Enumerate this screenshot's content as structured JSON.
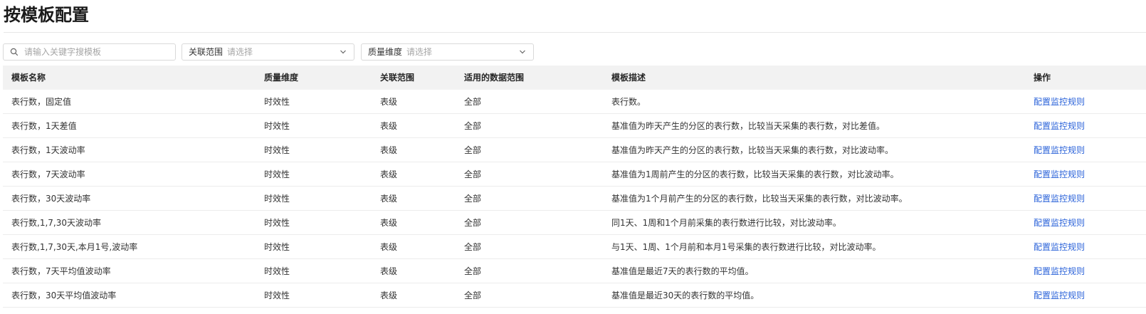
{
  "page": {
    "title": "按模板配置"
  },
  "filters": {
    "search_placeholder": "请输入关键字搜模板",
    "scope": {
      "label": "关联范围",
      "placeholder": "请选择"
    },
    "dimension": {
      "label": "质量维度",
      "placeholder": "请选择"
    }
  },
  "table": {
    "headers": [
      "模板名称",
      "质量维度",
      "关联范围",
      "适用的数据范围",
      "模板描述",
      "操作"
    ],
    "rows": [
      {
        "name": "表行数，固定值",
        "dimension": "时效性",
        "scope": "表级",
        "data_range": "全部",
        "desc": "表行数。",
        "action": "配置监控规则"
      },
      {
        "name": "表行数，1天差值",
        "dimension": "时效性",
        "scope": "表级",
        "data_range": "全部",
        "desc": "基准值为昨天产生的分区的表行数，比较当天采集的表行数，对比差值。",
        "action": "配置监控规则"
      },
      {
        "name": "表行数，1天波动率",
        "dimension": "时效性",
        "scope": "表级",
        "data_range": "全部",
        "desc": "基准值为昨天产生的分区的表行数，比较当天采集的表行数，对比波动率。",
        "action": "配置监控规则"
      },
      {
        "name": "表行数，7天波动率",
        "dimension": "时效性",
        "scope": "表级",
        "data_range": "全部",
        "desc": "基准值为1周前产生的分区的表行数，比较当天采集的表行数，对比波动率。",
        "action": "配置监控规则"
      },
      {
        "name": "表行数，30天波动率",
        "dimension": "时效性",
        "scope": "表级",
        "data_range": "全部",
        "desc": "基准值为1个月前产生的分区的表行数，比较当天采集的表行数，对比波动率。",
        "action": "配置监控规则"
      },
      {
        "name": "表行数,1,7,30天波动率",
        "dimension": "时效性",
        "scope": "表级",
        "data_range": "全部",
        "desc": "同1天、1周和1个月前采集的表行数进行比较，对比波动率。",
        "action": "配置监控规则"
      },
      {
        "name": "表行数,1,7,30天,本月1号,波动率",
        "dimension": "时效性",
        "scope": "表级",
        "data_range": "全部",
        "desc": "与1天、1周、1个月前和本月1号采集的表行数进行比较，对比波动率。",
        "action": "配置监控规则"
      },
      {
        "name": "表行数，7天平均值波动率",
        "dimension": "时效性",
        "scope": "表级",
        "data_range": "全部",
        "desc": "基准值是最近7天的表行数的平均值。",
        "action": "配置监控规则"
      },
      {
        "name": "表行数，30天平均值波动率",
        "dimension": "时效性",
        "scope": "表级",
        "data_range": "全部",
        "desc": "基准值是最近30天的表行数的平均值。",
        "action": "配置监控规则"
      }
    ]
  },
  "colors": {
    "link": "#2a62d9",
    "header_bg": "#f2f2f2"
  }
}
